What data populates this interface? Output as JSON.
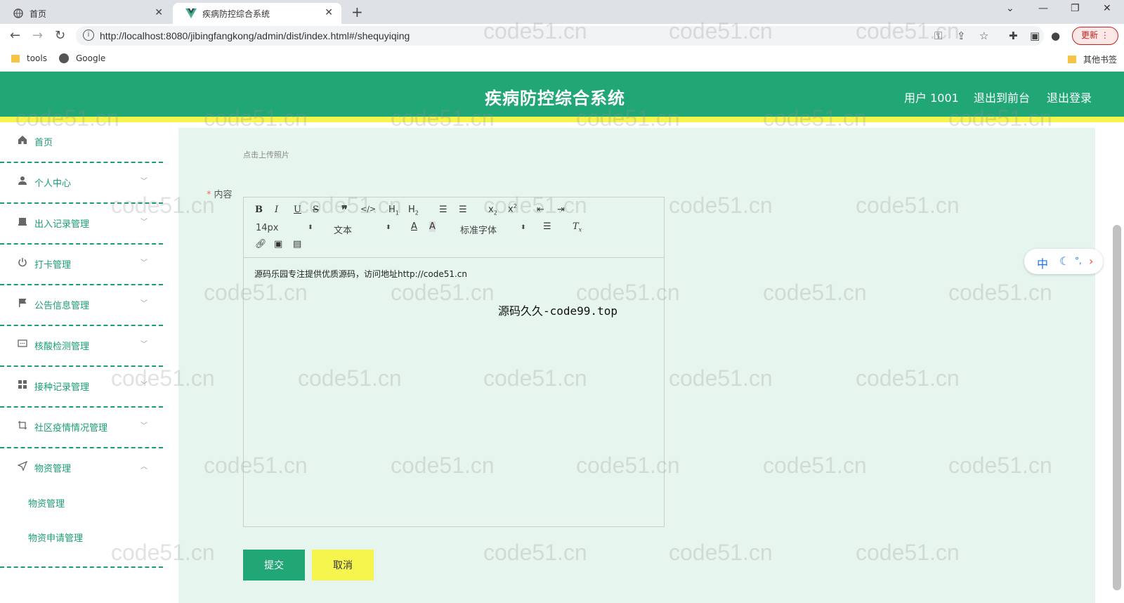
{
  "browser": {
    "tabs": [
      {
        "title": "首页"
      },
      {
        "title": "疾病防控综合系统"
      }
    ],
    "new_tab": "+",
    "url": "http://localhost:8080/jibingfangkong/admin/dist/index.html#/shequyiqing",
    "update_label": "更新",
    "bookmarks": [
      "tools",
      "Google"
    ],
    "other_bookmarks": "其他书签"
  },
  "header": {
    "title": "疾病防控综合系统",
    "user": "用户 1001",
    "back_front": "退出到前台",
    "logout": "退出登录",
    "colors": {
      "primary": "#21a675",
      "accent": "#f5f54e"
    }
  },
  "sidebar": {
    "items": [
      {
        "label": "首页",
        "icon": "home-icon"
      },
      {
        "label": "个人中心",
        "icon": "user-icon"
      },
      {
        "label": "出入记录管理",
        "icon": "record-icon"
      },
      {
        "label": "打卡管理",
        "icon": "power-icon"
      },
      {
        "label": "公告信息管理",
        "icon": "flag-icon"
      },
      {
        "label": "核酸检测管理",
        "icon": "message-icon"
      },
      {
        "label": "接种记录管理",
        "icon": "grid-icon"
      },
      {
        "label": "社区疫情情况管理",
        "icon": "crop-icon"
      },
      {
        "label": "物资管理",
        "icon": "send-icon"
      }
    ],
    "sub_items": [
      "物资管理",
      "物资申请管理"
    ]
  },
  "form": {
    "upload_hint": "点击上传照片",
    "content_label": "内容",
    "required_mark": "*",
    "editor": {
      "font_size": "14px",
      "block_format": "文本",
      "font_family": "标准字体",
      "content": "源码乐园专注提供优质源码，访问地址http://code51.cn",
      "overlay": "源码久久-code99.top"
    },
    "submit": "提交",
    "cancel": "取消"
  },
  "ime": {
    "lang": "中"
  },
  "watermark": "code51.cn"
}
